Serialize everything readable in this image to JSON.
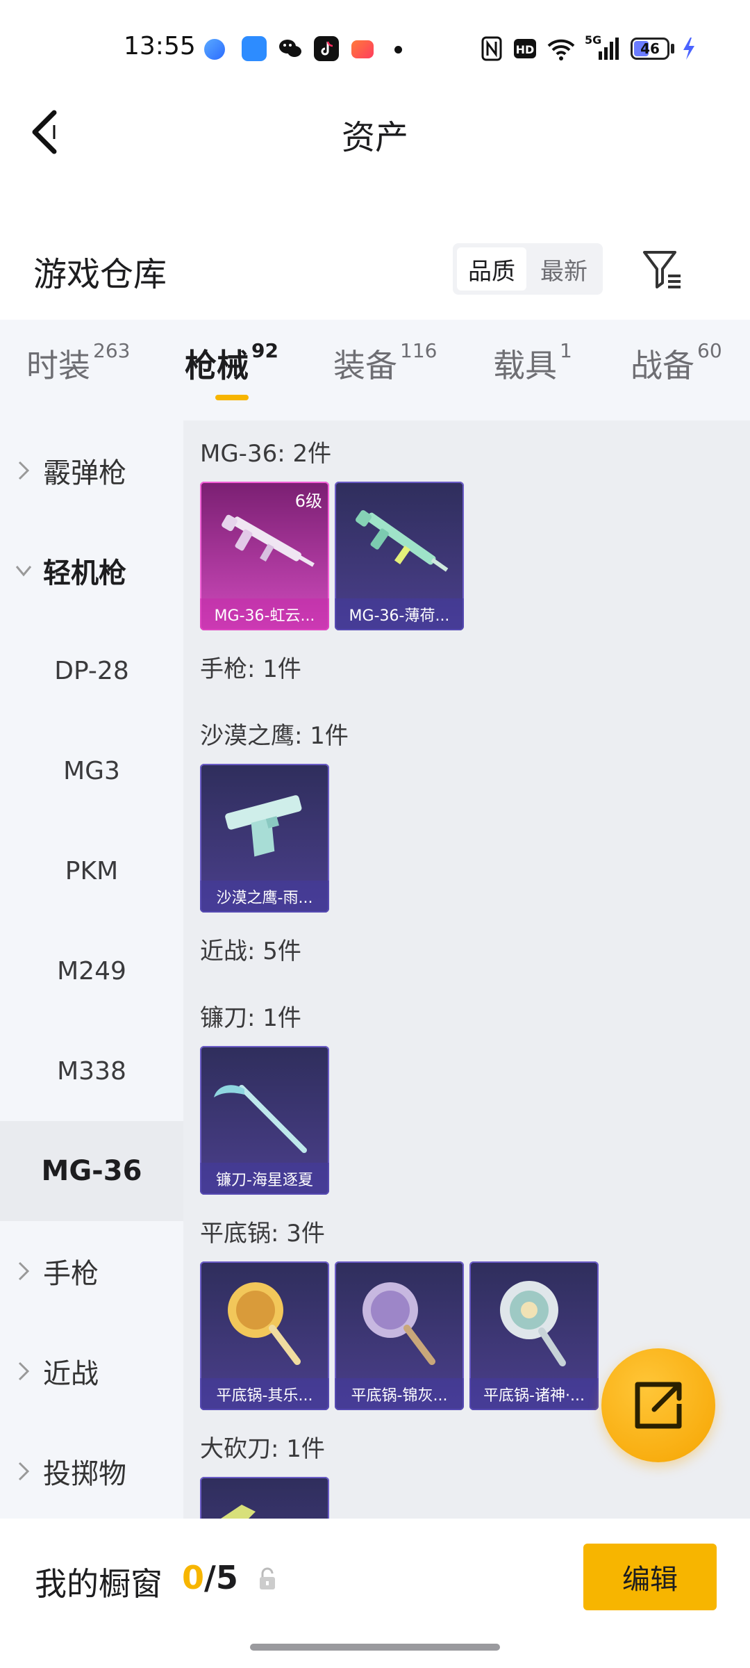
{
  "status_bar": {
    "time": "13:55",
    "battery": "46",
    "battery_level": 0.46,
    "network": "5G",
    "icons": [
      "nfc-icon",
      "hd-icon",
      "wifi-icon",
      "signal-icon",
      "battery-icon",
      "charging-icon"
    ]
  },
  "header": {
    "title": "资产"
  },
  "warehouse": {
    "title": "游戏仓库",
    "sort": [
      "品质",
      "最新"
    ],
    "sort_active": "品质"
  },
  "tabs": [
    {
      "label": "时装",
      "count": "263"
    },
    {
      "label": "枪械",
      "count": "92",
      "active": true
    },
    {
      "label": "装备",
      "count": "116"
    },
    {
      "label": "载具",
      "count": "1"
    },
    {
      "label": "战备",
      "count": "60"
    }
  ],
  "sidebar": {
    "items": [
      {
        "label": "霰弹枪",
        "type": "parent"
      },
      {
        "label": "轻机枪",
        "type": "parent-open"
      },
      {
        "label": "DP-28",
        "type": "sub"
      },
      {
        "label": "MG3",
        "type": "sub"
      },
      {
        "label": "PKM",
        "type": "sub"
      },
      {
        "label": "M249",
        "type": "sub"
      },
      {
        "label": "M338",
        "type": "sub"
      },
      {
        "label": "MG-36",
        "type": "selected"
      },
      {
        "label": "手枪",
        "type": "parent"
      },
      {
        "label": "近战",
        "type": "parent"
      },
      {
        "label": "投掷物",
        "type": "parent"
      }
    ]
  },
  "content": {
    "groups": [
      {
        "title": "MG-36: 2件",
        "items": [
          {
            "name": "MG-36-虹云...",
            "level": "6级",
            "rarity": "rare"
          },
          {
            "name": "MG-36-薄荷...",
            "rarity": "epic"
          }
        ]
      },
      {
        "title": "手枪: 1件",
        "items": []
      },
      {
        "title": "沙漠之鹰: 1件",
        "items": [
          {
            "name": "沙漠之鹰-雨...",
            "rarity": "epic"
          }
        ]
      },
      {
        "title": "近战: 5件",
        "items": []
      },
      {
        "title": "镰刀: 1件",
        "items": [
          {
            "name": "镰刀-海星逐夏",
            "rarity": "epic"
          }
        ]
      },
      {
        "title": "平底锅: 3件",
        "items": [
          {
            "name": "平底锅-其乐...",
            "rarity": "epic"
          },
          {
            "name": "平底锅-锦灰...",
            "rarity": "epic"
          },
          {
            "name": "平底锅-诸神·...",
            "rarity": "epic"
          }
        ]
      },
      {
        "title": "大砍刀: 1件",
        "items": [
          {
            "name": "",
            "rarity": "epic"
          }
        ]
      }
    ]
  },
  "bottom": {
    "label": "我的橱窗",
    "current": "0",
    "total": "/5",
    "edit": "编辑"
  },
  "colors": {
    "accent": "#f7b500",
    "rare": "#d04bbd",
    "epic": "#4b3f8c"
  }
}
